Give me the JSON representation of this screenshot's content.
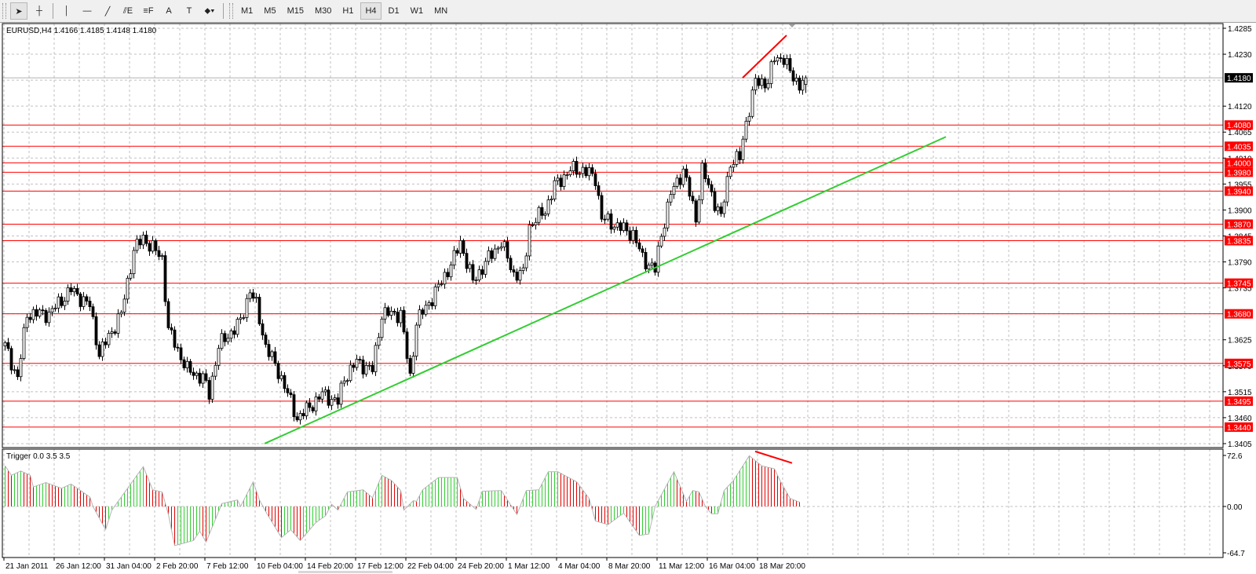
{
  "toolbar": {
    "tools": [
      {
        "name": "cursor",
        "glyph": "➤"
      },
      {
        "name": "crosshair",
        "glyph": "┼"
      },
      {
        "name": "vertical-line",
        "glyph": "│"
      },
      {
        "name": "horizontal-line",
        "glyph": "—"
      },
      {
        "name": "trendline",
        "glyph": "╱"
      },
      {
        "name": "equidistant-channel",
        "glyph": "⫽E"
      },
      {
        "name": "fibonacci",
        "glyph": "≡F"
      },
      {
        "name": "text",
        "glyph": "A"
      },
      {
        "name": "text-label",
        "glyph": "T"
      },
      {
        "name": "arrows",
        "glyph": "⬥▾"
      }
    ],
    "timeframes": [
      "M1",
      "M5",
      "M15",
      "M30",
      "H1",
      "H4",
      "D1",
      "W1",
      "MN"
    ],
    "active_timeframe": "H4"
  },
  "chart": {
    "header": "EURUSD,H4  1.4166 1.4185 1.4148 1.4180",
    "symbol": "EURUSD",
    "period": "H4",
    "ohlc": {
      "open": 1.4166,
      "high": 1.4185,
      "low": 1.4148,
      "close": 1.418
    },
    "current_price_label": "1.4180",
    "price_scale": [
      "1.4285",
      "1.4230",
      "1.4120",
      "1.4065",
      "1.4010",
      "1.3955",
      "1.3900",
      "1.3845",
      "1.3790",
      "1.3735",
      "1.3625",
      "1.3570",
      "1.3515",
      "1.3460",
      "1.3405"
    ],
    "levels": [
      "1.4080",
      "1.4035",
      "1.4000",
      "1.3980",
      "1.3940",
      "1.3870",
      "1.3835",
      "1.3745",
      "1.3680",
      "1.3575",
      "1.3495",
      "1.3440"
    ],
    "time_labels": [
      "21 Jan 2011",
      "26 Jan 12:00",
      "31 Jan 04:00",
      "2 Feb 20:00",
      "7 Feb 12:00",
      "10 Feb 04:00",
      "14 Feb 20:00",
      "17 Feb 12:00",
      "22 Feb 04:00",
      "24 Feb 20:00",
      "1 Mar 12:00",
      "4 Mar 04:00",
      "8 Mar 20:00",
      "11 Mar 12:00",
      "16 Mar 04:00",
      "18 Mar 20:00"
    ],
    "colors": {
      "level": "#ff0000",
      "trendline": "#32cd32",
      "bull": "#ffffff",
      "bear": "#000000",
      "grid": "#c0c0c0",
      "ind_up": "#32cd32",
      "ind_down": "#e00000"
    }
  },
  "indicator": {
    "header": "Trigger 0.0 3.5 3.5",
    "scale": [
      "72.6",
      "0.00",
      "-64.7"
    ]
  },
  "chart_data": {
    "type": "candlestick",
    "bars": 256,
    "price_range": [
      1.3405,
      1.4285
    ],
    "price_path": [
      [
        0,
        1.3612
      ],
      [
        4,
        1.3544
      ],
      [
        7,
        1.368
      ],
      [
        14,
        1.368
      ],
      [
        21,
        1.3731
      ],
      [
        27,
        1.3697
      ],
      [
        30,
        1.3595
      ],
      [
        37,
        1.368
      ],
      [
        41,
        1.3815
      ],
      [
        44,
        1.3841
      ],
      [
        50,
        1.3798
      ],
      [
        52,
        1.3646
      ],
      [
        58,
        1.3561
      ],
      [
        63,
        1.3544
      ],
      [
        65,
        1.351
      ],
      [
        68,
        1.3612
      ],
      [
        75,
        1.3663
      ],
      [
        78,
        1.3731
      ],
      [
        80,
        1.3697
      ],
      [
        83,
        1.3612
      ],
      [
        88,
        1.3544
      ],
      [
        93,
        1.3459
      ],
      [
        96,
        1.3476
      ],
      [
        101,
        1.351
      ],
      [
        106,
        1.3493
      ],
      [
        108,
        1.3544
      ],
      [
        112,
        1.3578
      ],
      [
        117,
        1.3561
      ],
      [
        120,
        1.368
      ],
      [
        126,
        1.368
      ],
      [
        129,
        1.3544
      ],
      [
        131,
        1.3663
      ],
      [
        136,
        1.3714
      ],
      [
        139,
        1.3748
      ],
      [
        143,
        1.3798
      ],
      [
        145,
        1.3832
      ],
      [
        149,
        1.3748
      ],
      [
        154,
        1.3798
      ],
      [
        158,
        1.3832
      ],
      [
        162,
        1.3764
      ],
      [
        165,
        1.3764
      ],
      [
        167,
        1.3866
      ],
      [
        172,
        1.39
      ],
      [
        175,
        1.3951
      ],
      [
        180,
        1.3985
      ],
      [
        184,
        1.3985
      ],
      [
        188,
        1.3968
      ],
      [
        190,
        1.3883
      ],
      [
        195,
        1.3866
      ],
      [
        200,
        1.3849
      ],
      [
        203,
        1.3798
      ],
      [
        207,
        1.3773
      ],
      [
        209,
        1.3849
      ],
      [
        212,
        1.3934
      ],
      [
        216,
        1.3985
      ],
      [
        220,
        1.3883
      ],
      [
        222,
        1.3985
      ],
      [
        226,
        1.3917
      ],
      [
        228,
        1.3883
      ],
      [
        231,
        1.4002
      ],
      [
        234,
        1.401
      ],
      [
        236,
        1.4087
      ],
      [
        239,
        1.4171
      ],
      [
        243,
        1.4171
      ],
      [
        245,
        1.4222
      ],
      [
        248,
        1.4222
      ],
      [
        250,
        1.419
      ],
      [
        253,
        1.4166
      ],
      [
        255,
        1.418
      ]
    ],
    "trendline_prices": [
      [
        86,
        1.3405
      ],
      [
        303,
        1.4055
      ]
    ],
    "price_divergence_line": [
      [
        235,
        1.418
      ],
      [
        249,
        1.427
      ]
    ],
    "indicator_range": [
      -64.7,
      72.6
    ],
    "indicator_path": [
      [
        0,
        56
      ],
      [
        2,
        43
      ],
      [
        5,
        49
      ],
      [
        8,
        43
      ],
      [
        9,
        27
      ],
      [
        13,
        33
      ],
      [
        18,
        25
      ],
      [
        21,
        31
      ],
      [
        27,
        13
      ],
      [
        28,
        0
      ],
      [
        32,
        -32
      ],
      [
        34,
        -5
      ],
      [
        40,
        31
      ],
      [
        44,
        55
      ],
      [
        47,
        23
      ],
      [
        50,
        20
      ],
      [
        52,
        -11
      ],
      [
        54,
        -54
      ],
      [
        60,
        -47
      ],
      [
        62,
        -34
      ],
      [
        64,
        -49
      ],
      [
        68,
        -7
      ],
      [
        69,
        4
      ],
      [
        74,
        9
      ],
      [
        75,
        0
      ],
      [
        79,
        34
      ],
      [
        81,
        9
      ],
      [
        83,
        -7
      ],
      [
        88,
        -43
      ],
      [
        91,
        -32
      ],
      [
        94,
        -47
      ],
      [
        99,
        -22
      ],
      [
        102,
        -13
      ],
      [
        104,
        3
      ],
      [
        106,
        -5
      ],
      [
        109,
        20
      ],
      [
        114,
        23
      ],
      [
        117,
        12
      ],
      [
        120,
        43
      ],
      [
        123,
        36
      ],
      [
        126,
        22
      ],
      [
        127,
        -5
      ],
      [
        130,
        8
      ],
      [
        131,
        7
      ],
      [
        133,
        23
      ],
      [
        138,
        40
      ],
      [
        144,
        40
      ],
      [
        146,
        11
      ],
      [
        150,
        -4
      ],
      [
        152,
        21
      ],
      [
        158,
        22
      ],
      [
        163,
        -11
      ],
      [
        166,
        22
      ],
      [
        170,
        23
      ],
      [
        173,
        48
      ],
      [
        176,
        48
      ],
      [
        182,
        34
      ],
      [
        186,
        11
      ],
      [
        188,
        -20
      ],
      [
        192,
        -25
      ],
      [
        197,
        -9
      ],
      [
        202,
        -40
      ],
      [
        205,
        -38
      ],
      [
        207,
        0
      ],
      [
        213,
        48
      ],
      [
        217,
        7
      ],
      [
        219,
        22
      ],
      [
        221,
        20
      ],
      [
        223,
        0
      ],
      [
        225,
        -10
      ],
      [
        227,
        -10
      ],
      [
        229,
        22
      ],
      [
        232,
        36
      ],
      [
        237,
        70
      ],
      [
        239,
        63
      ],
      [
        241,
        56
      ],
      [
        245,
        52
      ],
      [
        247,
        34
      ],
      [
        250,
        11
      ],
      [
        253,
        6
      ]
    ],
    "indicator_divergence_line": [
      [
        239,
        76
      ],
      [
        250,
        60
      ]
    ]
  }
}
